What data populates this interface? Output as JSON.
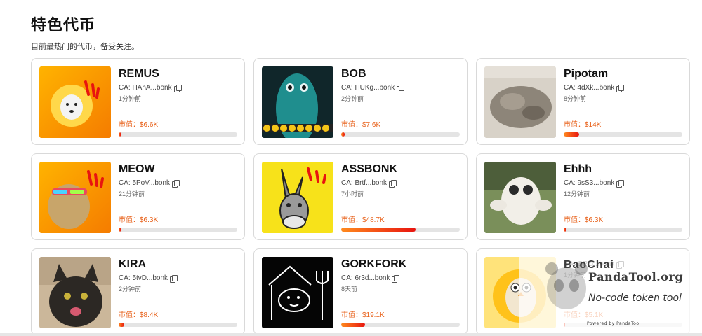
{
  "section": {
    "title": "特色代币",
    "subtitle": "目前最热门的代币，备受关注。"
  },
  "tokens": [
    {
      "name": "REMUS",
      "ca": "CA: HAhA...bonk",
      "time": "1分钟前",
      "mcap": "市值：$6.6K",
      "progress": 0.02
    },
    {
      "name": "BOB",
      "ca": "CA: HUKg...bonk",
      "time": "2分钟前",
      "mcap": "市值：$7.6K",
      "progress": 0.03
    },
    {
      "name": "Pipotam",
      "ca": "CA: 4dXk...bonk",
      "time": "8分钟前",
      "mcap": "市值：$14K",
      "progress": 0.13
    },
    {
      "name": "MEOW",
      "ca": "CA: 5PoV...bonk",
      "time": "21分钟前",
      "mcap": "市值：$6.3K",
      "progress": 0.015
    },
    {
      "name": "ASSBONK",
      "ca": "CA: Brtf...bonk",
      "time": "7小时前",
      "mcap": "市值：$48.7K",
      "progress": 0.63
    },
    {
      "name": "Ehhh",
      "ca": "CA: 9sS3...bonk",
      "time": "12分钟前",
      "mcap": "市值：$6.3K",
      "progress": 0.015
    },
    {
      "name": "KIRA",
      "ca": "CA: 5tvD...bonk",
      "time": "2分钟前",
      "mcap": "市值：$8.4K",
      "progress": 0.045
    },
    {
      "name": "GORKFORK",
      "ca": "CA: 6r3d...bonk",
      "time": "8天前",
      "mcap": "市值：$19.1K",
      "progress": 0.2
    },
    {
      "name": "",
      "ca": "CA: GPtq...bonk",
      "time": "1分钟前",
      "mcap": "市值：$5.1K",
      "progress": 0.01
    }
  ],
  "watermark": {
    "brand": "BaoChai",
    "site": "PandaTool.org",
    "tagline": "No-code token tool",
    "powered": "Powered by PandaTool"
  },
  "colors": {
    "accent": "#e8611a",
    "bar_start": "#ff8a1e",
    "bar_end": "#e8140f",
    "bar_track": "#e4e4e4"
  }
}
